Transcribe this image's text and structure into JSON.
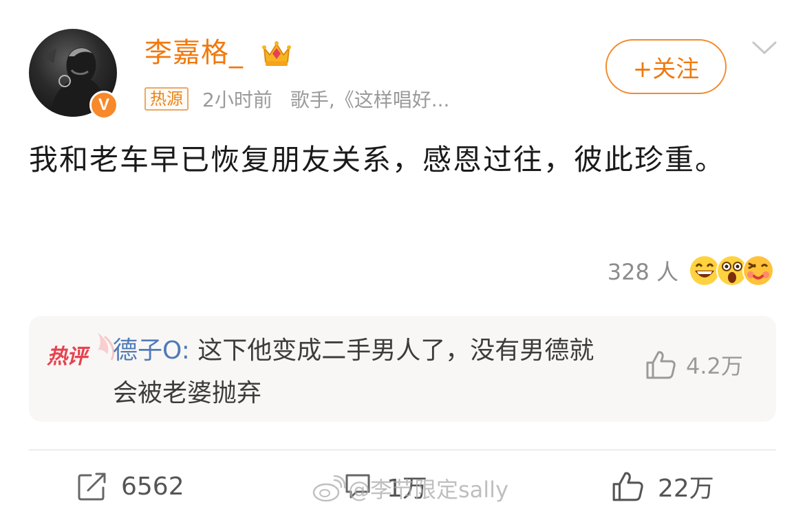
{
  "post": {
    "author": {
      "name": "李嘉格_",
      "verified_badge": "V",
      "source_tag": "热源",
      "time": "2小时前",
      "description": "歌手,《这样唱好..."
    },
    "follow_label": "+关注",
    "text": "我和老车早已恢复朋友关系，感恩过往，彼此珍重。",
    "reactions": {
      "count_label": "328 人",
      "emojis": [
        "grin-emoji-icon",
        "shocked-emoji-icon",
        "blush-emoji-icon"
      ]
    }
  },
  "hot_comment": {
    "tag": "热评",
    "commenter": "德子O:",
    "text": "这下他变成二手男人了，没有男德就会被老婆抛弃",
    "likes": "4.2万"
  },
  "actions": {
    "repost_count": "6562",
    "comment_count": "1万",
    "like_count": "22万"
  },
  "watermark": "@李节限定sally",
  "colors": {
    "accent": "#f0790f",
    "commenter": "#4f7bb8",
    "hot_tag": "#e8414f"
  }
}
